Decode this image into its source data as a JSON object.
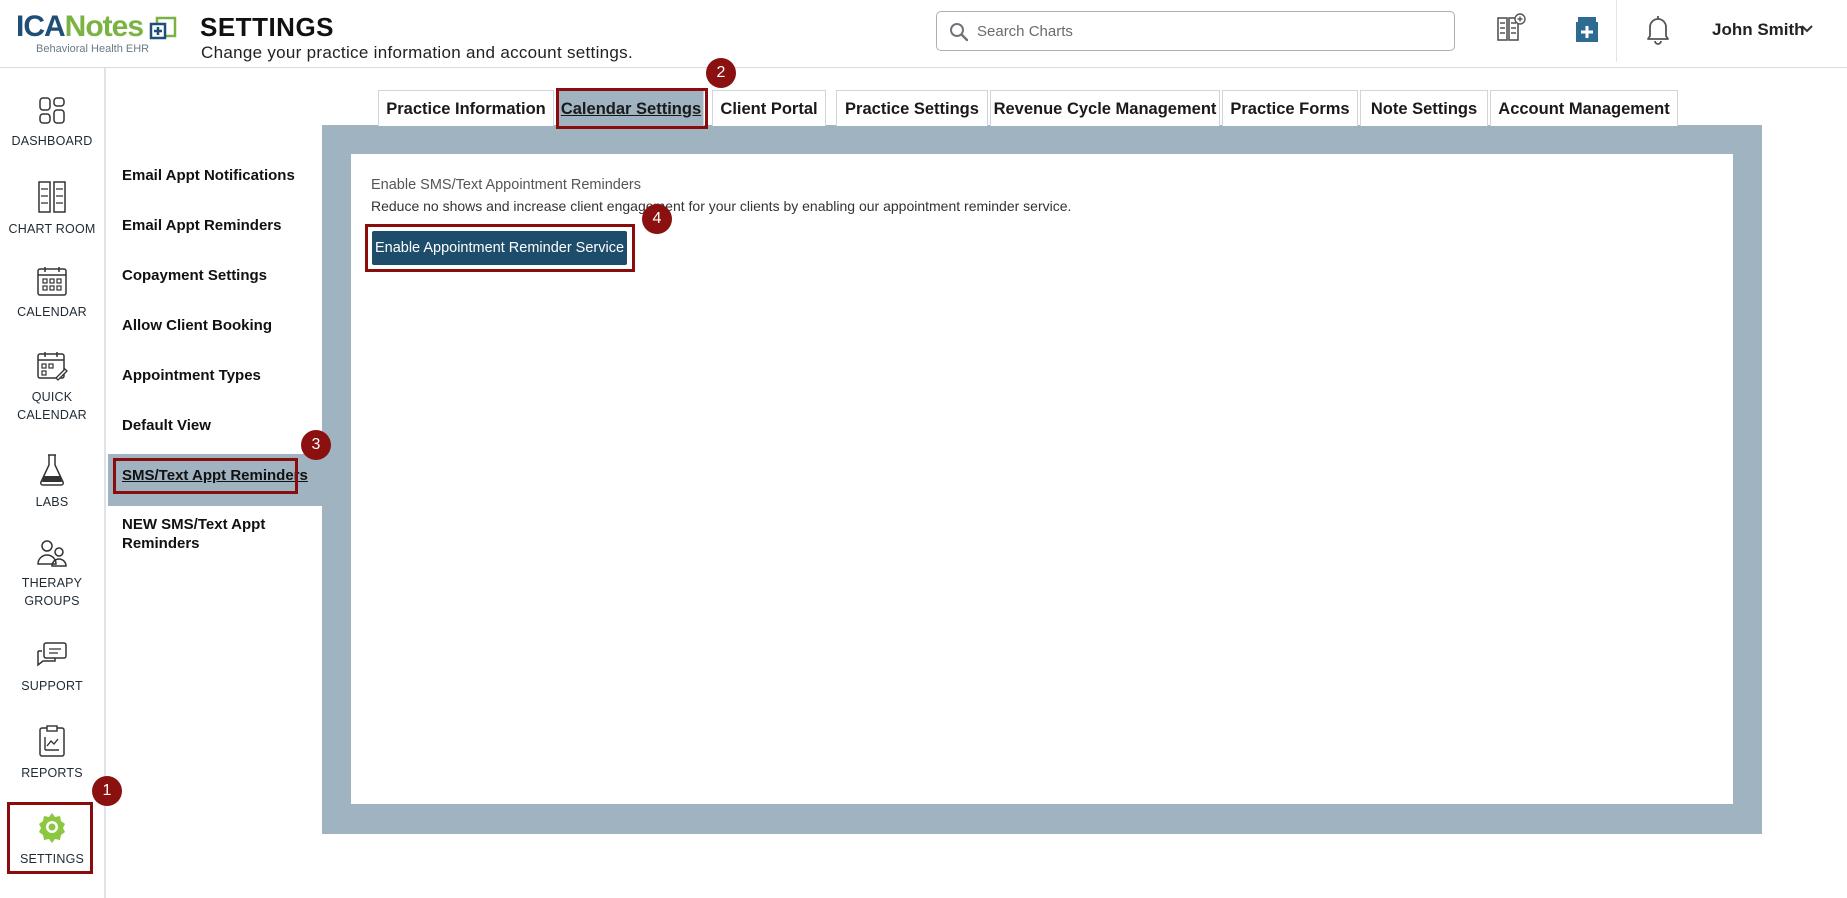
{
  "header": {
    "logo": {
      "main_left": "ICA",
      "main_right": "Notes",
      "subtitle": "Behavioral Health EHR"
    },
    "title": "SETTINGS",
    "subtitle": "Change your practice information and account settings.",
    "search": {
      "placeholder": "Search Charts"
    },
    "icons": [
      "chart-add-icon",
      "prescription-add-icon",
      "bell-icon"
    ],
    "user": {
      "name": "John Smith"
    }
  },
  "leftnav": {
    "items": [
      {
        "label": "DASHBOARD",
        "icon": "dashboard-icon"
      },
      {
        "label": "CHART ROOM",
        "icon": "chart-room-icon"
      },
      {
        "label": "CALENDAR",
        "icon": "calendar-icon"
      },
      {
        "label": "QUICK CALENDAR",
        "icon": "quick-calendar-icon"
      },
      {
        "label": "LABS",
        "icon": "flask-icon"
      },
      {
        "label": "THERAPY GROUPS",
        "icon": "group-icon"
      },
      {
        "label": "SUPPORT",
        "icon": "chat-icon"
      },
      {
        "label": "REPORTS",
        "icon": "report-icon"
      },
      {
        "label": "SETTINGS",
        "icon": "gear-icon",
        "active": true
      }
    ]
  },
  "tabs": [
    {
      "label": "Practice Information"
    },
    {
      "label": "Calendar Settings",
      "active": true
    },
    {
      "label": "Client Portal"
    },
    {
      "label": "Practice Settings"
    },
    {
      "label": "Revenue Cycle Management"
    },
    {
      "label": "Practice Forms"
    },
    {
      "label": "Note Settings"
    },
    {
      "label": "Account Management"
    }
  ],
  "subnav": {
    "items": [
      {
        "label": "Email Appt Notifications"
      },
      {
        "label": "Email Appt Reminders"
      },
      {
        "label": "Copayment Settings"
      },
      {
        "label": "Allow Client Booking"
      },
      {
        "label": "Appointment Types"
      },
      {
        "label": "Default View"
      },
      {
        "label": "SMS/Text Appt Reminders",
        "active": true
      },
      {
        "label": "NEW SMS/Text Appt Reminders"
      }
    ]
  },
  "content": {
    "section_title": "Enable SMS/Text Appointment Reminders",
    "section_desc": "Reduce no shows and increase client engagement for your clients by enabling our appointment reminder service.",
    "enable_button": "Enable Appointment Reminder Service"
  },
  "annotations": {
    "badges": [
      "1",
      "2",
      "3",
      "4"
    ],
    "highlight_color": "#8b0c0c"
  },
  "colors": {
    "accent_dark": "#1e4d6b",
    "active_bg": "#9fb3c0",
    "brand_blue": "#1f4e79",
    "brand_green": "#7ab342"
  }
}
